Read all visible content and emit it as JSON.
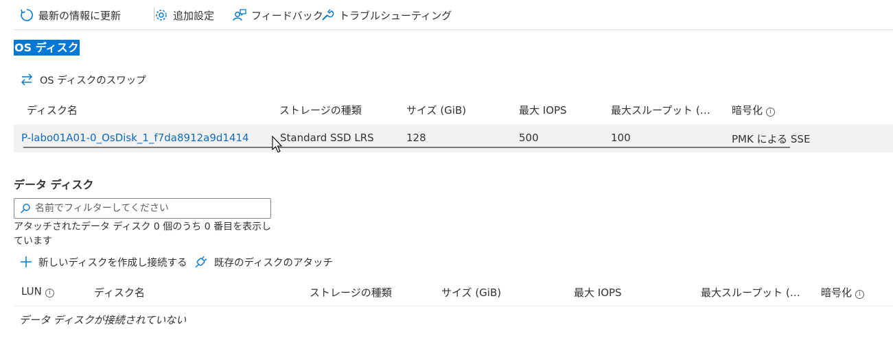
{
  "toolbar": {
    "refresh": "最新の情報に更新",
    "settings": "追加設定",
    "feedback": "フィードバック",
    "troubleshoot": "トラブルシューティング"
  },
  "os_disk": {
    "title": "OS ディスク",
    "swap_label": "OS ディスクのスワップ",
    "columns": [
      "ディスク名",
      "ストレージの種類",
      "サイズ (GiB)",
      "最大 IOPS",
      "最大スループット (…",
      "暗号化"
    ],
    "row": {
      "name": "P-labo01A01-0_OsDisk_1_f7da8912a9d1414",
      "storage": "Standard SSD LRS",
      "size": "128",
      "iops": "500",
      "throughput": "100",
      "encryption": "PMK による SSE"
    }
  },
  "data_disks": {
    "title": "データ ディスク",
    "filter_placeholder": "名前でフィルターしてください",
    "count_text": "アタッチされたデータ ディスク 0 個のうち 0 番目を表示しています",
    "create_label": "新しいディスクを作成し接続する",
    "attach_label": "既存のディスクのアタッチ",
    "columns": [
      "LUN",
      "ディスク名",
      "ストレージの種類",
      "サイズ (GiB)",
      "最大 IOPS",
      "最大スループット (…",
      "暗号化"
    ],
    "empty_text": "データ ディスクが接続されていない"
  },
  "icons": {
    "refresh": "refresh-icon",
    "settings": "gear-icon",
    "feedback": "feedback-icon",
    "troubleshoot": "wrench-icon",
    "swap": "swap-arrows-icon",
    "add": "plus-icon",
    "attach": "plug-icon",
    "search": "search-icon",
    "info": "info-icon"
  },
  "colors": {
    "accent": "#0078d4",
    "link": "#0f6cbd",
    "row_bg": "#f3f2f1"
  }
}
